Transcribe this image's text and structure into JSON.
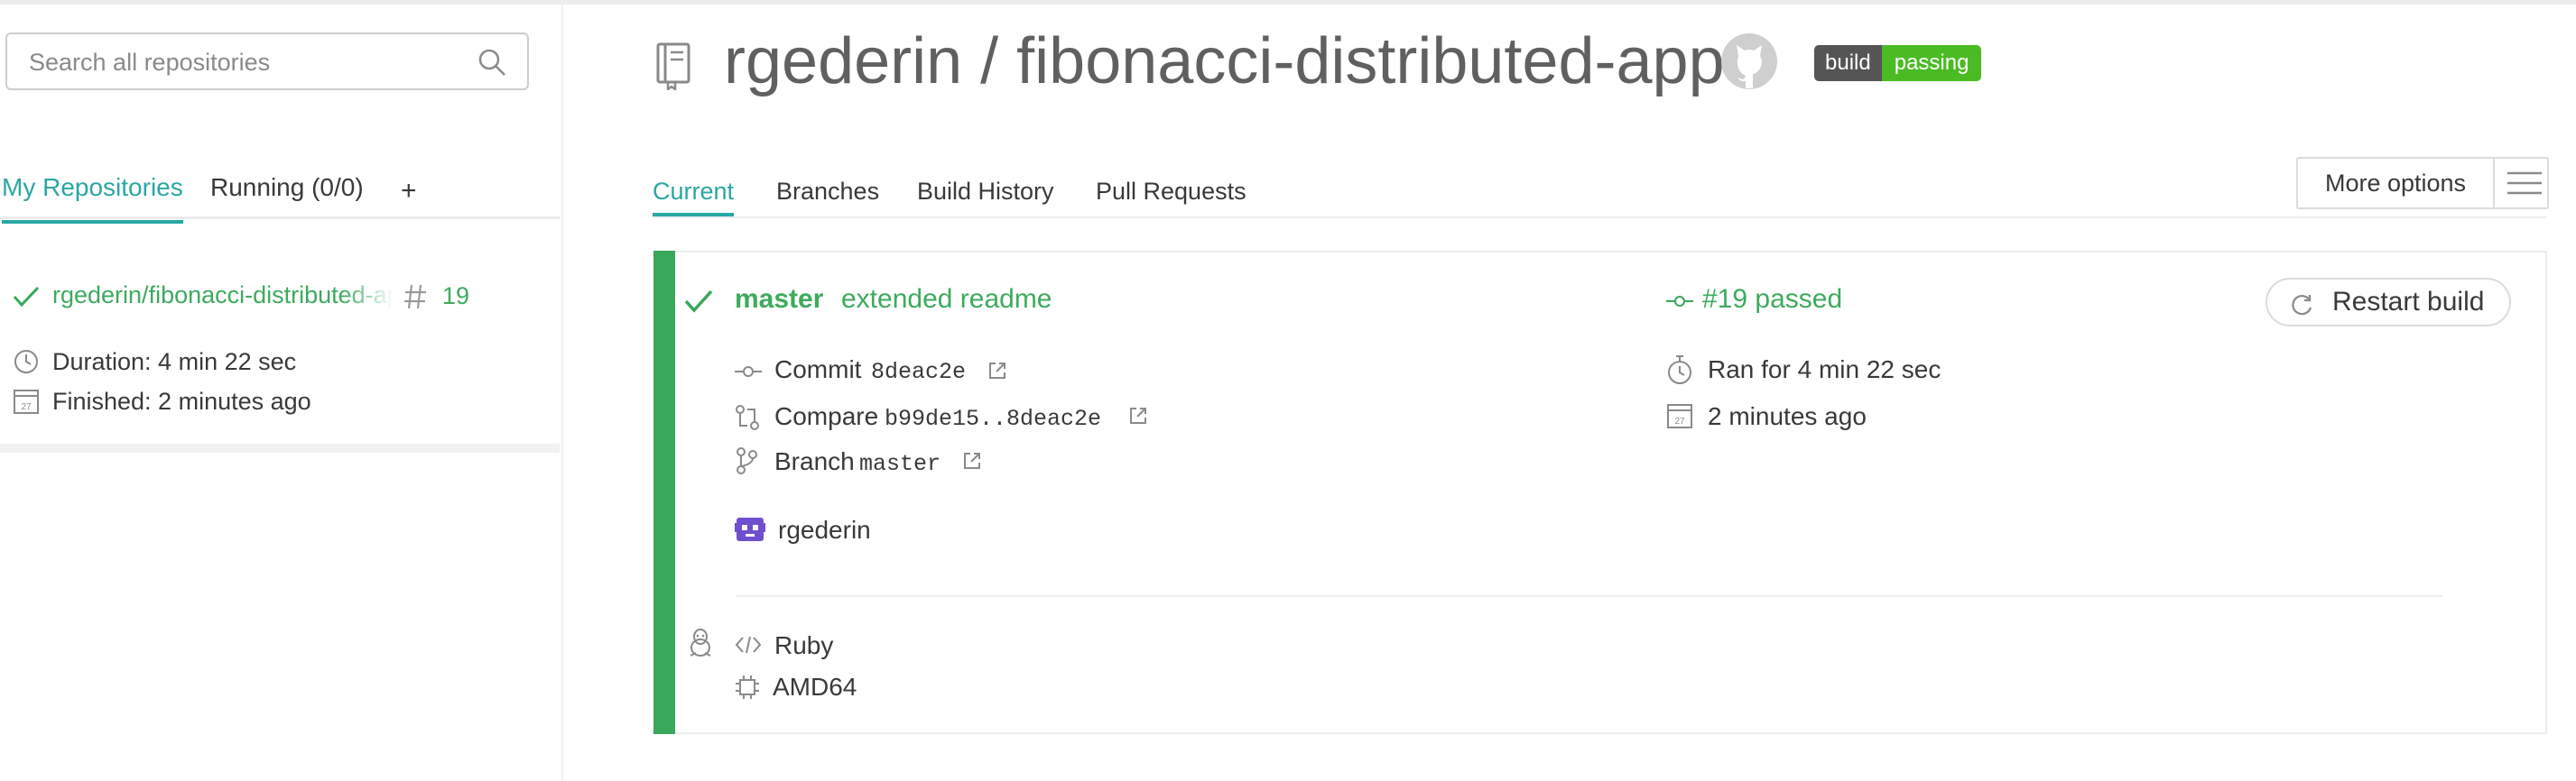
{
  "sidebar": {
    "search_placeholder": "Search all repositories",
    "tabs": [
      "My Repositories",
      "Running (0/0)",
      "+"
    ],
    "repo": {
      "name": "rgederin/fibonacci-distributed-app",
      "build_number": "19",
      "duration": "Duration: 4 min 22 sec",
      "finished": "Finished: 2 minutes ago"
    }
  },
  "header": {
    "title": "rgederin / fibonacci-distributed-app",
    "badge_left": "build",
    "badge_right": "passing"
  },
  "main_tabs": [
    "Current",
    "Branches",
    "Build History",
    "Pull Requests"
  ],
  "more_options": "More options",
  "build": {
    "branch": "master",
    "message": "extended readme",
    "status": "#19 passed",
    "restart": "Restart build",
    "commit_label": "Commit",
    "commit_hash": "8deac2e",
    "compare_label": "Compare",
    "compare_range": "b99de15..8deac2e",
    "branch_label": "Branch",
    "branch_value": "master",
    "author": "rgederin",
    "ran_for": "Ran for 4 min 22 sec",
    "finished": "2 minutes ago",
    "language": "Ruby",
    "arch": "AMD64",
    "calendar_day": "27"
  },
  "colors": {
    "accent": "#2aa7a4",
    "passed": "#39a85b",
    "badge_passing": "#4bbb24"
  }
}
